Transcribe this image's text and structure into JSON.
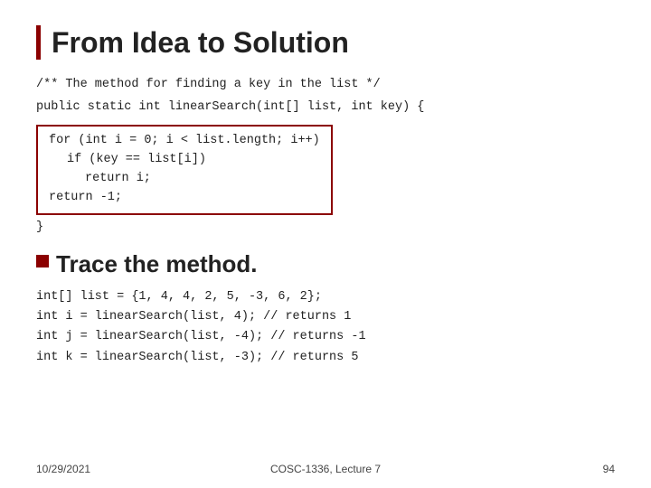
{
  "title": "From Idea to Solution",
  "comment_line": "/** The method for finding a key in the list */",
  "public_line": "public static int linearSearch(int[] list, int key) {",
  "code_box_lines": [
    "for (int i = 0; i < list.length; i++)",
    "  if (key == list[i])",
    "    return i;",
    "return -1;"
  ],
  "closing_brace": "}",
  "bullet_text": "Trace the method.",
  "trace_lines": [
    "int[] list = {1, 4, 4, 2, 5, -3, 6, 2};",
    "int  i = linearSearch(list,  4);  // returns 1",
    "int  j = linearSearch(list, -4);  // returns -1",
    "int  k = linearSearch(list, -3);  // returns 5"
  ],
  "footer": {
    "left": "10/29/2021",
    "center": "COSC-1336, Lecture 7",
    "right": "94"
  }
}
